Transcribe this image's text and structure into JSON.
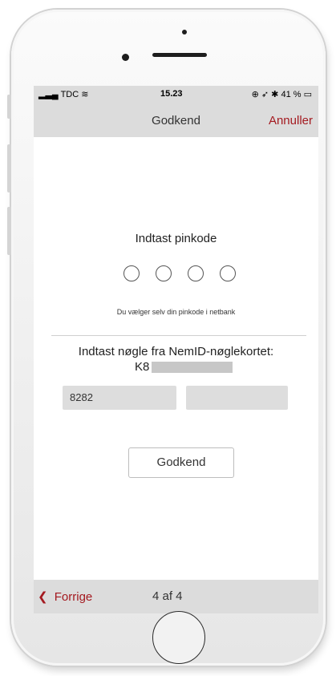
{
  "status_bar": {
    "carrier": "TDC",
    "time": "15.23",
    "battery": "41 %",
    "icons": [
      "signal-icon",
      "wifi-icon",
      "location-icon",
      "alarm-icon",
      "bluetooth-icon",
      "battery-icon"
    ]
  },
  "nav": {
    "title": "Godkend",
    "cancel_label": "Annuller"
  },
  "pin": {
    "title": "Indtast pinkode",
    "dot_count": 4,
    "hint": "Du vælger selv din pinkode i netbank"
  },
  "key": {
    "label": "Indtast nøgle fra NemID-nøglekortet:",
    "code_prefix": "K8",
    "field_1_value": "8282",
    "field_2_value": ""
  },
  "approve_label": "Godkend",
  "bottom": {
    "back_chevron": "❮",
    "back_label": "Forrige",
    "page_indicator": "4 af 4"
  },
  "colors": {
    "accent": "#a41a20",
    "bar_bg": "#dcdcdc",
    "field_bg": "#dddddd"
  }
}
